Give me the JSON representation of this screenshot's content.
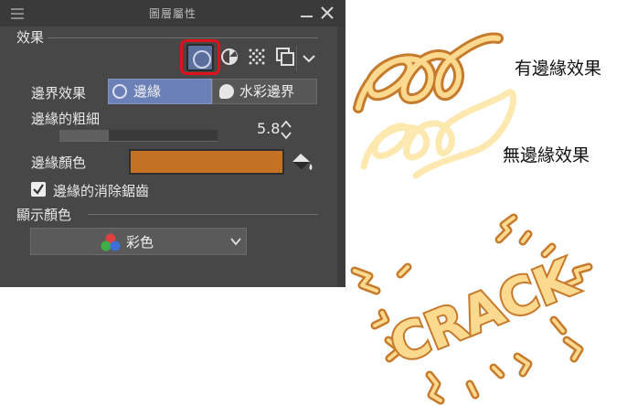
{
  "window": {
    "title": "圖層屬性"
  },
  "effect_section": {
    "label": "效果",
    "toolbar": [
      "no-effect",
      "tone-effect",
      "dots-effect",
      "layer-effect",
      "dropdown"
    ]
  },
  "border_effect": {
    "label": "邊界效果",
    "options": [
      {
        "label": "邊緣",
        "active": true
      },
      {
        "label": "水彩邊界",
        "active": false
      }
    ]
  },
  "border_width": {
    "label": "邊緣的粗細",
    "value": "5.8",
    "fill_fraction": 0.31
  },
  "border_color": {
    "label": "邊緣顏色",
    "color": "#c37125"
  },
  "antialias": {
    "label": "邊緣的消除鋸齒",
    "checked": true
  },
  "display_color": {
    "section_label": "顯示顏色",
    "selected": "彩色"
  },
  "illustration": {
    "caption_with": "有邊緣效果",
    "caption_without": "無邊緣效果",
    "crack_text": "CRACK"
  },
  "colors": {
    "accent_blue": "#6c80b8",
    "highlight_red": "#e0111b",
    "border_orange": "#c37125",
    "light_yellow": "#fde8b0"
  }
}
